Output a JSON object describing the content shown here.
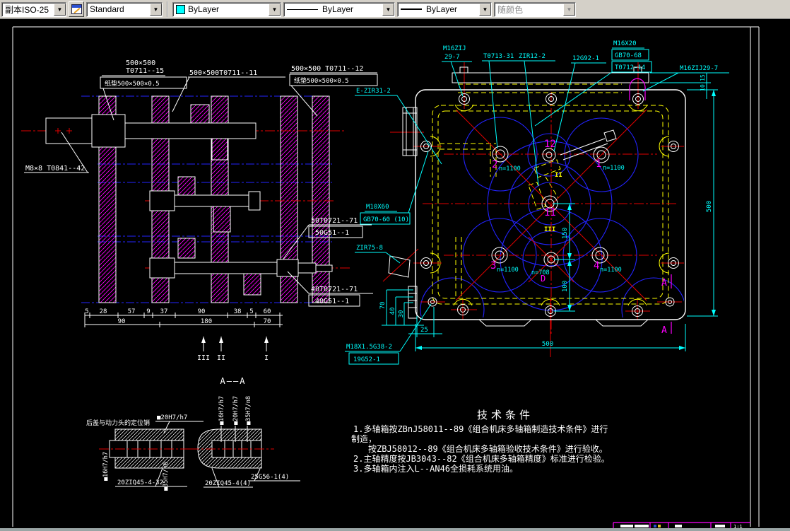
{
  "toolbar": {
    "dim_style": "副本ISO-25",
    "text_style": "Standard",
    "color": "ByLayer",
    "linetype": "ByLayer",
    "lineweight": "ByLayer",
    "plot_style": "随颜色"
  },
  "left_view": {
    "pad1a": "500×500",
    "pad1b": "T0711--15",
    "pad1_box": "纸垫500×500×0.5",
    "pad2": "500×500T0711--11",
    "pad3": "500×500 T0711--12",
    "pad3_box": "纸垫500×500×0.5",
    "shaft_label": "M8×8 T0841--42",
    "g50a": "50T0721--71",
    "g50b": "50G51--1",
    "g40a": "40T0721--71",
    "g40b": "40G51--1",
    "dims_row1": [
      "5",
      "28",
      "57",
      "9",
      "37",
      "90",
      "38",
      "5",
      "60"
    ],
    "dims_row2": [
      "90",
      "180",
      "70"
    ],
    "sections": [
      "III",
      "II",
      "I"
    ]
  },
  "front_view": {
    "labels": {
      "m16zij_a": "M16ZIJ",
      "m16zij_b": "29-7",
      "t0713": "T0713-31",
      "zir12": "ZIR12-2",
      "g92": "12G92-1",
      "m16x20": "M16X20",
      "gb70_68": "GB70-68",
      "t0712": "T0712-14",
      "m16zij29": "M16ZIJ29-7",
      "ezir31": "E-ZIR31-2",
      "m10x60": "M10X60",
      "gb70_60": "GB70-60 (10)",
      "zir75": "ZIR75-8",
      "m18": "M18X1.5G38-2",
      "g52": "19G52-1"
    },
    "spindles": {
      "s1": "1",
      "s2": "2",
      "s3": "3",
      "s4": "4",
      "s11": "11",
      "s12": "12",
      "n1": "n=1100",
      "n2": "n=1100",
      "n3": "n=1100",
      "n4": "n=1100",
      "n0": "n=708",
      "d": "D",
      "r2": "II",
      "r3": "III"
    },
    "dims": {
      "d150": "150",
      "d100": "100",
      "d25": "25",
      "d500b": "500",
      "d500r": "500",
      "d70": "70",
      "d40": "40",
      "d30": "30",
      "d15": "15",
      "d10": "10"
    },
    "section_a1": "A",
    "section_a2": "A"
  },
  "details": {
    "title": "A——A",
    "note": "后盖与动力头的定位销",
    "l20": "■20H7/h7",
    "l16": "■16H7/h7",
    "l35": "■35H7/n6",
    "lpart": "20ZIQ45-4-32",
    "r16": "■16H7/h7",
    "r20": "■20H7/h7",
    "r35": "■35H7/n8",
    "rpart1": "20ZIQ45-4(4)",
    "rpart2": "25G56-1(4)"
  },
  "tech": {
    "title": "技术条件",
    "line1": "1.多轴箱按ZBnJ58011--89《组合机床多轴箱制造技术条件》进行",
    "line2": "制造，",
    "line3": "按ZBJ58012--89《组合机床多轴箱验收技术条件》进行验收。",
    "line4": "2.主轴精度按JB3043--82《组合机床多轴箱精度》标准进行检验。",
    "line5": "3.多轴箱内注入L--AN46全损耗系统用油。"
  },
  "title_block": {
    "scale": "1:1"
  },
  "colors": {
    "cyan": "#00ffff",
    "magenta": "#ff00ff",
    "red": "#e00000",
    "blue": "#2323ff",
    "yellow": "#ffff00",
    "white": "#ffffff",
    "toolbar_bg": "#d4d0c8"
  }
}
